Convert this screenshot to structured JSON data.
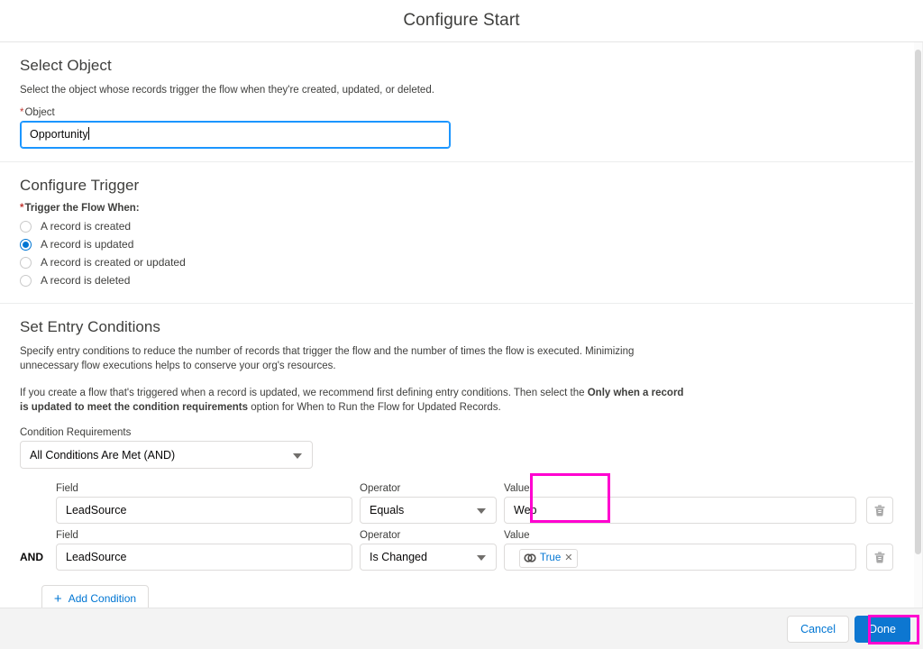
{
  "header": {
    "title": "Configure Start"
  },
  "select_object": {
    "title": "Select Object",
    "description": "Select the object whose records trigger the flow when they're created, updated, or deleted.",
    "object_label": "Object",
    "object_required_mark": "*",
    "object_value": "Opportunity"
  },
  "configure_trigger": {
    "title": "Configure Trigger",
    "legend_required_mark": "*",
    "legend": "Trigger the Flow When:",
    "options": [
      {
        "label": "A record is created",
        "selected": false
      },
      {
        "label": "A record is updated",
        "selected": true
      },
      {
        "label": "A record is created or updated",
        "selected": false
      },
      {
        "label": "A record is deleted",
        "selected": false
      }
    ]
  },
  "entry_conditions": {
    "title": "Set Entry Conditions",
    "description_1": "Specify entry conditions to reduce the number of records that trigger the flow and the number of times the flow is executed. Minimizing unnecessary flow executions helps to conserve your org's resources.",
    "description_2_part1": "If you create a flow that's triggered when a record is updated, we recommend first defining entry conditions. Then select the ",
    "description_2_bold1": "Only when a record is updated to meet the condition requirements",
    "description_2_part2": " option for When to Run the Flow for Updated Records.",
    "condition_requirements_label": "Condition Requirements",
    "condition_requirements_value": "All Conditions Are Met (AND)",
    "column_headers": {
      "field": "Field",
      "operator": "Operator",
      "value": "Value"
    },
    "and_label": "AND",
    "rows": [
      {
        "logic_prefix": "",
        "field": "LeadSource",
        "operator": "Equals",
        "value_text": "Web",
        "value_pill": null
      },
      {
        "logic_prefix": "AND",
        "field": "LeadSource",
        "operator": "Is Changed",
        "value_text": "",
        "value_pill": "True"
      }
    ],
    "add_condition_label": "Add Condition",
    "delete_icon": "trash-icon"
  },
  "footer": {
    "cancel_label": "Cancel",
    "done_label": "Done"
  },
  "colors": {
    "brand_blue": "#0d77d1",
    "link_blue": "#0176d3",
    "focus_blue": "#1b96ff",
    "required_red": "#c23934",
    "highlight_magenta": "#ff00d0",
    "footer_gray": "#f3f3f3",
    "border_gray": "#dddbda",
    "text_dark": "#3e3e3c"
  }
}
